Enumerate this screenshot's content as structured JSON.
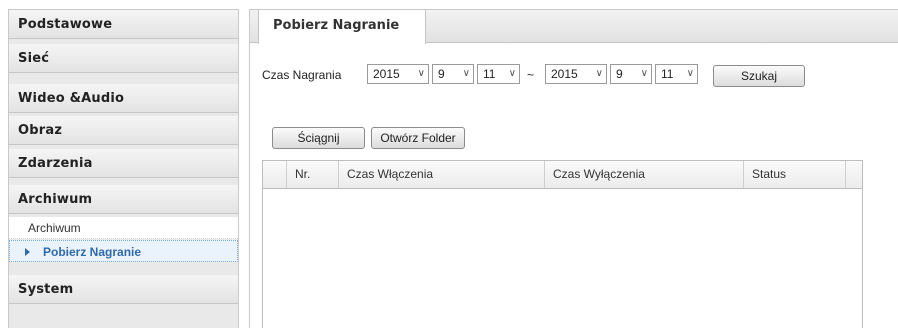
{
  "sidebar": {
    "items": [
      {
        "label": "Podstawowe"
      },
      {
        "label": "Sieć"
      },
      {
        "label": "Wideo &Audio"
      },
      {
        "label": "Obraz"
      },
      {
        "label": "Zdarzenia"
      },
      {
        "label": "Archiwum"
      },
      {
        "label": "System"
      }
    ],
    "subitems": [
      {
        "label": "Archiwum"
      },
      {
        "label": "Pobierz Nagranie",
        "selected": true
      }
    ]
  },
  "tab": {
    "label": "Pobierz Nagranie"
  },
  "filter": {
    "label": "Czas Nagrania",
    "start": {
      "year": "2015",
      "month": "9",
      "day": "11"
    },
    "separator": "~",
    "end": {
      "year": "2015",
      "month": "9",
      "day": "11"
    },
    "search_label": "Szukaj"
  },
  "actions": {
    "download_label": "Ściągnij",
    "open_folder_label": "Otwórz Folder"
  },
  "table": {
    "columns": [
      "Nr.",
      "Czas Włączenia",
      "Czas Wyłączenia",
      "Status"
    ],
    "rows": []
  },
  "icons": {
    "selected_arrow": "caret-right-icon",
    "dropdown": "chevron-down-icon"
  },
  "colors": {
    "selected_text": "#2f6aab",
    "selected_bg": "#eaf3fb"
  }
}
